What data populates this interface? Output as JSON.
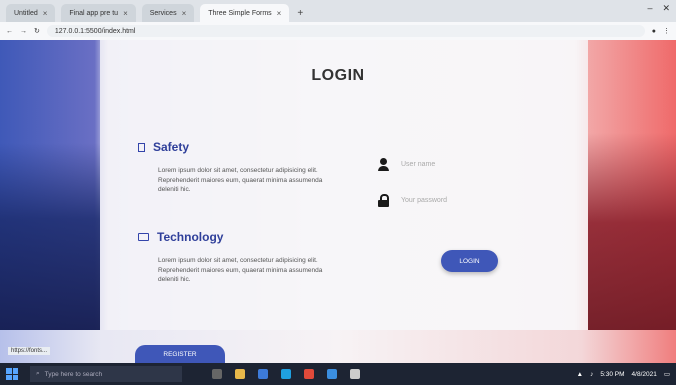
{
  "browser": {
    "tabs": [
      {
        "label": "Untitled",
        "active": false
      },
      {
        "label": "Final app pre tu",
        "active": false
      },
      {
        "label": "Services",
        "active": false
      },
      {
        "label": "Three Simple Forms",
        "active": true
      }
    ],
    "new_tab": "+",
    "address": "127.0.0.1:5500/index.html",
    "close_glyph": "×"
  },
  "page": {
    "title": "LOGIN",
    "features": [
      {
        "icon": "document-icon",
        "heading": "Safety",
        "text": "Lorem ipsum dolor sit amet, consectetur adipisicing elit. Reprehenderit maiores eum, quaerat minima assumenda deleniti hic."
      },
      {
        "icon": "monitor-icon",
        "heading": "Technology",
        "text": "Lorem ipsum dolor sit amet, consectetur adipisicing elit. Reprehenderit maiores eum, quaerat minima assumenda deleniti hic."
      }
    ],
    "username_label": "User name",
    "password_label": "Your password",
    "login_button": "LOGIN",
    "register_button": "REGISTER",
    "status_url": "https://fonts..."
  },
  "taskbar": {
    "search_placeholder": "Type here to search",
    "time": "5:30 PM",
    "date": "4/8/2021"
  },
  "colors": {
    "accent": "#3f57b8",
    "left_panel": "#3f59b8",
    "right_panel": "#ef6a6a"
  }
}
